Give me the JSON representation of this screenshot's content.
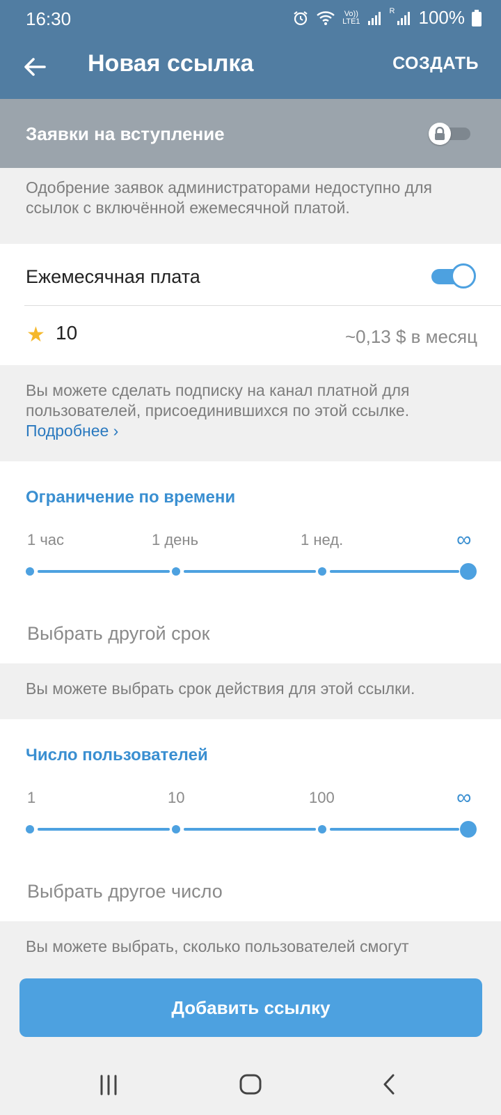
{
  "status_bar": {
    "time": "16:30",
    "network_label_top": "Vo))",
    "network_label_bottom": "LTE1",
    "roaming_label": "R",
    "battery": "100%",
    "icons": [
      "alarm-icon",
      "wifi-icon",
      "signal-icon",
      "signal-icon",
      "battery-icon"
    ]
  },
  "app_bar": {
    "title": "Новая ссылка",
    "action": "СОЗДАТЬ",
    "back_icon": "arrow-left-icon"
  },
  "join_requests": {
    "label": "Заявки на вступление",
    "enabled": false,
    "locked": true,
    "hint": "Одобрение заявок администраторами недоступно для ссылок с включённой ежемесячной платой."
  },
  "monthly_fee": {
    "label": "Ежемесячная плата",
    "enabled": true,
    "star_icon": "star-icon",
    "stars_value": "10",
    "usd_equivalent": "~0,13 $ в месяц",
    "hint": "Вы можете сделать подписку на канал платной для пользователей, присоединившихся по этой ссылке.",
    "more_link": "Подробнее ›"
  },
  "time_limit": {
    "title": "Ограничение по времени",
    "ticks": [
      "1 час",
      "1 день",
      "1 нед.",
      "∞"
    ],
    "selected_index": 3,
    "custom_option": "Выбрать другой срок",
    "hint": "Вы можете выбрать срок действия для этой ссылки."
  },
  "user_limit": {
    "title": "Число пользователей",
    "ticks": [
      "1",
      "10",
      "100",
      "∞"
    ],
    "selected_index": 3,
    "custom_option": "Выбрать другое число",
    "hint": "Вы можете выбрать, сколько пользователей смогут"
  },
  "add_button": "Добавить ссылку",
  "nav_bar": {
    "icons": [
      "recents-icon",
      "home-icon",
      "back-icon"
    ]
  },
  "colors": {
    "header": "#517da2",
    "accent": "#4da1e0",
    "section_title": "#3a8fd1",
    "link": "#2a79bf"
  }
}
